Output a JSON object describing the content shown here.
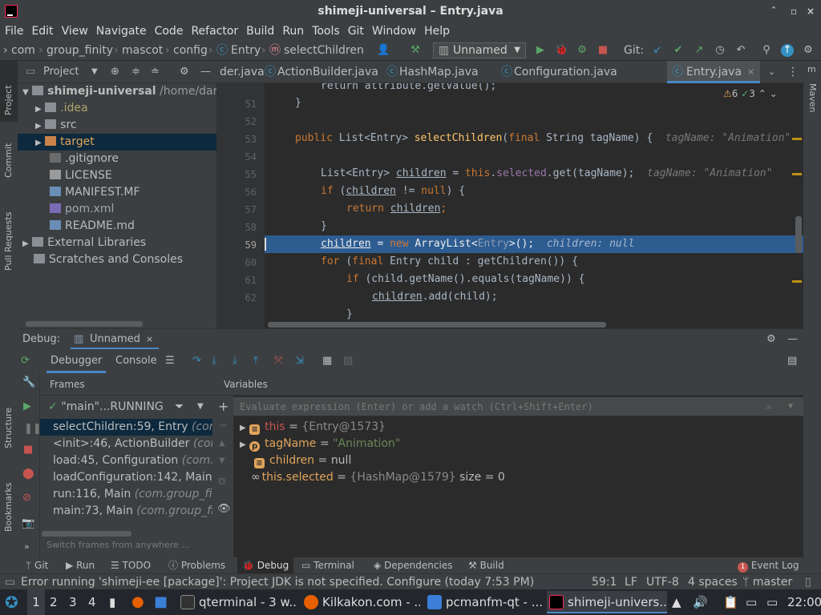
{
  "window": {
    "title": "shimeji-universal – Entry.java",
    "controls": [
      "ˆ",
      "×"
    ]
  },
  "menu": [
    "File",
    "Edit",
    "View",
    "Navigate",
    "Code",
    "Refactor",
    "Build",
    "Run",
    "Tools",
    "Git",
    "Window",
    "Help"
  ],
  "breadcrumbs": [
    "com",
    "group_finity",
    "mascot",
    "config",
    "Entry",
    "selectChildren"
  ],
  "run_config": "Unnamed",
  "git_label": "Git:",
  "project": {
    "header": "Project",
    "tree": [
      {
        "label": "shimeji-universal",
        "extra": "/home/dartz"
      },
      {
        "label": ".idea"
      },
      {
        "label": "src"
      },
      {
        "label": "target"
      },
      {
        "label": ".gitignore"
      },
      {
        "label": "LICENSE"
      },
      {
        "label": "MANIFEST.MF"
      },
      {
        "label": "pom.xml"
      },
      {
        "label": "README.md"
      },
      {
        "label": "External Libraries"
      },
      {
        "label": "Scratches and Consoles"
      }
    ]
  },
  "left_strip": [
    "Project",
    "Commit",
    "Pull Requests",
    "Structure",
    "Bookmarks"
  ],
  "right_strip": [
    "Maven"
  ],
  "tabs": [
    "der.java",
    "ActionBuilder.java",
    "HashMap.java",
    "Configuration.java",
    "Entry.java"
  ],
  "inspections": {
    "warnings": "6",
    "ok": "3"
  },
  "code": {
    "line_numbers": [
      "51",
      "52",
      "53",
      "54",
      "55",
      "56",
      "57",
      "58",
      "59",
      "60",
      "61",
      "62"
    ],
    "top_partial": "return attribute.getValue();",
    "l51": "}",
    "l53a": "public ",
    "l53b": "List<Entry> ",
    "l53c": "selectChildren",
    "l53d": "(",
    "l53e": "final ",
    "l53f": "String tagName) {",
    "l53hint": "tagName: \"Animation\"",
    "l55a": "List<Entry> ",
    "l55b": "children",
    "l55c": " = ",
    "l55d": "this",
    "l55e": ".",
    "l55f": "selected",
    "l55g": ".get(tagName);",
    "l55hint": "tagName: \"Animation\"",
    "l56a": "if ",
    "l56b": "(",
    "l56c": "children",
    "l56d": " != ",
    "l56e": "null",
    "l56f": ") {",
    "l57a": "return ",
    "l57b": "children",
    "l57c": ";",
    "l58": "}",
    "l59a": "children",
    "l59b": " = ",
    "l59c": "new ",
    "l59d": "ArrayList<",
    "l59e": "Entry",
    "l59f": ">();",
    "l59hint": "children: null",
    "l60a": "for ",
    "l60b": "(",
    "l60c": "final ",
    "l60d": "Entry child : getChildren()) {",
    "l61a": "if ",
    "l61b": "(child.getName().equals(tagName)) {",
    "l62a": "children",
    "l62b": ".add(child);",
    "l63": "}"
  },
  "debug": {
    "label": "Debug:",
    "session": "Unnamed",
    "tab_debugger": "Debugger",
    "tab_console": "Console",
    "frames_header": "Frames",
    "variables_header": "Variables",
    "thread": "\"main\"...RUNNING",
    "frames": [
      {
        "method": "selectChildren:59, Entry",
        "pkg": "(com.g"
      },
      {
        "method": "<init>:46, ActionBuilder",
        "pkg": "(com."
      },
      {
        "method": "load:45, Configuration",
        "pkg": "(com.gr"
      },
      {
        "method": "loadConfiguration:142, Main",
        "pkg": "(c"
      },
      {
        "method": "run:116, Main",
        "pkg": "(com.group_finit"
      },
      {
        "method": "main:73, Main",
        "pkg": "(com.group_fini"
      }
    ],
    "switch_hint": "Switch frames from anywhere ...",
    "eval_placeholder": "Evaluate expression (Enter) or add a watch (Ctrl+Shift+Enter)",
    "vars": [
      {
        "name": "this",
        "eq": " = ",
        "value": "{Entry@1573}",
        "extra": ""
      },
      {
        "name": "tagName",
        "eq": " = ",
        "value": "\"Animation\"",
        "extra": ""
      },
      {
        "name": "children",
        "eq": " = ",
        "value": "null",
        "extra": ""
      },
      {
        "name": "this.selected",
        "eq": " = ",
        "value": "{HashMap@1579}",
        "extra": " size = 0"
      }
    ]
  },
  "bottom_tools": [
    "Git",
    "Run",
    "TODO",
    "Problems",
    "Debug",
    "Terminal",
    "Dependencies",
    "Build"
  ],
  "event_log": {
    "count": "1",
    "label": "Event Log"
  },
  "status": {
    "message": "Error running 'shimeji-ee [package]': Project JDK is not specified. Configure (today 7:53 PM)",
    "position": "59:1",
    "line_sep": "LF",
    "encoding": "UTF-8",
    "indent": "4 spaces",
    "branch": "master"
  },
  "taskbar": {
    "workspaces": [
      "1",
      "2",
      "3",
      "4"
    ],
    "apps": [
      "qterminal - 3 w...",
      "Kilkakon.com - ...",
      "pcmanfm-qt - ...",
      "shimeji-univers..."
    ],
    "clock": "22:00"
  },
  "colors": {
    "accent": "#2d5c91",
    "keyword": "#cc7832",
    "field": "#9876aa",
    "string": "#6a8759",
    "run_green": "#59a869",
    "stop_red": "#c75450"
  }
}
